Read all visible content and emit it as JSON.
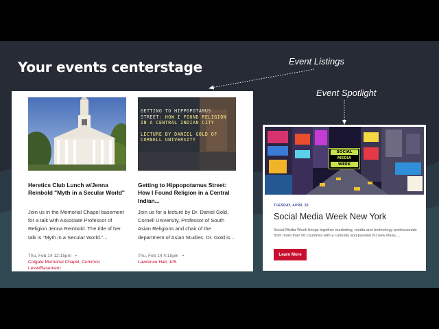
{
  "headline": "Your events centerstage",
  "callouts": {
    "listings": "Event Listings",
    "spotlight": "Event Spotlight"
  },
  "listings": [
    {
      "image_alt": "Memorial Chapel",
      "title": "Heretics Club Lunch w/Jenna Reinbold \"Myth in a Secular World\"",
      "description": "Join us in the Memorial Chapel basement for a talk with Associate Professor of Religion Jenna Reinbold. The title of her talk is \"Myth in a Secular World.\"...",
      "datetime": "Thu, Feb 14 12:15pm",
      "location": "Colgate Memorial Chapel, Common Level/Basement"
    },
    {
      "image_overlay": {
        "lead": "Getting to Hippopotamus Street:",
        "main": "How I Found Religion in a Central Indian City",
        "lecture": "Lecture by Daniel Gold of Cornell University"
      },
      "title": "Getting to Hippopotamus Street: How I Found Religion in a Central Indian...",
      "description": "Join us for a lecture by Dr. Daniel Gold, Cornell University, Professor of South Asian Religions and chair of the department of Asian Studies. Dr. Gold is...",
      "datetime": "Thu, Feb 14 4:15pm",
      "location": "Lawrence Hall, 105"
    }
  ],
  "spotlight": {
    "logo": [
      "SOCIAL",
      "MEDIA",
      "WEEK"
    ],
    "date": "TUESDAY, APRIL 30",
    "title": "Social Media Week New York",
    "description": "Social Media Week brings together marketing, media and technology professionals from more than 50 countries with a curiosity and passion for new ideas,...",
    "button": "Learn More"
  },
  "colors": {
    "slide_background": "#262b35",
    "accent": "#c8102e",
    "date_label": "#3d4a9a",
    "logo_green": "#c5e14b"
  }
}
